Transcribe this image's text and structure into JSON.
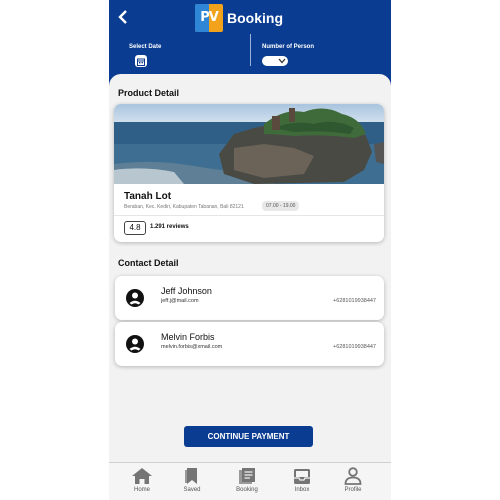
{
  "header": {
    "title": "Booking",
    "logo_text": "PV",
    "select_date_label": "Select Date",
    "number_person_label": "Number of Person"
  },
  "product": {
    "section_title": "Product Detail",
    "name": "Tanah Lot",
    "address": "Beraban, Kec. Kediri, Kabupaten Tabanan, Bali 82121",
    "hours": "07.00 - 19.00",
    "rating": "4.8",
    "reviews": "1.291 reviews"
  },
  "contacts": {
    "section_title": "Contact Detail",
    "items": [
      {
        "name": "Jeff Johnson",
        "email": "jeff.j@mail.com",
        "phone": "+6281019938447"
      },
      {
        "name": "Melvin Forbis",
        "email": "melvin.forbis@xmail.com",
        "phone": "+6281019938447"
      }
    ]
  },
  "actions": {
    "continue_label": "CONTINUE PAYMENT"
  },
  "nav": {
    "items": [
      {
        "label": "Home",
        "icon": "home-icon"
      },
      {
        "label": "Saved",
        "icon": "bookmark-icon"
      },
      {
        "label": "Booking",
        "icon": "booking-icon"
      },
      {
        "label": "Inbox",
        "icon": "inbox-icon"
      },
      {
        "label": "Profile",
        "icon": "profile-icon"
      }
    ]
  },
  "colors": {
    "primary": "#0a3d91",
    "background": "#f2f2f2",
    "nav_icon": "#757575"
  }
}
